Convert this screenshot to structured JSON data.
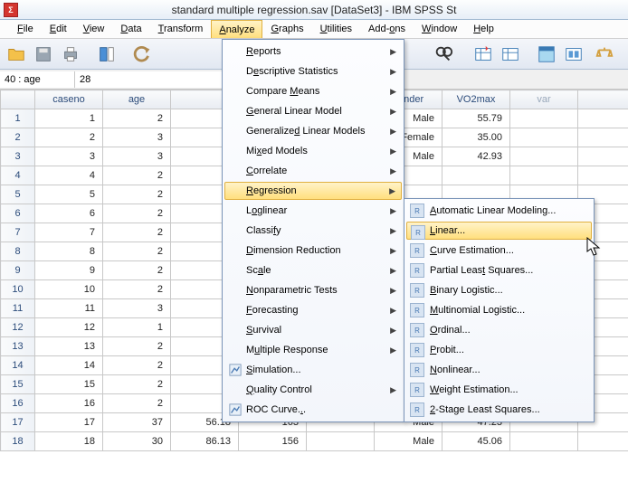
{
  "title": "standard multiple regression.sav [DataSet3] - IBM SPSS St",
  "menubar": {
    "file": "File",
    "edit": "Edit",
    "view": "View",
    "data": "Data",
    "transform": "Transform",
    "analyze": "Analyze",
    "graphs": "Graphs",
    "utilities": "Utilities",
    "addons": "Add-ons",
    "window": "Window",
    "help": "Help"
  },
  "nav": {
    "label": "40 : age",
    "value": "28"
  },
  "columns": {
    "c0": "caseno",
    "c1": "age",
    "c2": "gender",
    "c3": "VO2max",
    "c4": "var"
  },
  "rows": [
    {
      "n": "1",
      "caseno": "1",
      "age": "2",
      "gender": "Male",
      "vo2": "55.79"
    },
    {
      "n": "2",
      "caseno": "2",
      "age": "3",
      "gender": "Female",
      "vo2": "35.00"
    },
    {
      "n": "3",
      "caseno": "3",
      "age": "3",
      "gender": "Male",
      "vo2": "42.93"
    },
    {
      "n": "4",
      "caseno": "4",
      "age": "2",
      "gender": "",
      "vo2": ""
    },
    {
      "n": "5",
      "caseno": "5",
      "age": "2",
      "gender": "",
      "vo2": ""
    },
    {
      "n": "6",
      "caseno": "6",
      "age": "2",
      "gender": "",
      "vo2": ""
    },
    {
      "n": "7",
      "caseno": "7",
      "age": "2",
      "gender": "",
      "vo2": ""
    },
    {
      "n": "8",
      "caseno": "8",
      "age": "2",
      "gender": "",
      "vo2": ""
    },
    {
      "n": "9",
      "caseno": "9",
      "age": "2",
      "gender": "",
      "vo2": ""
    },
    {
      "n": "10",
      "caseno": "10",
      "age": "2",
      "gender": "",
      "vo2": ""
    },
    {
      "n": "11",
      "caseno": "11",
      "age": "3",
      "gender": "",
      "vo2": ""
    },
    {
      "n": "12",
      "caseno": "12",
      "age": "1",
      "gender": "",
      "vo2": ""
    },
    {
      "n": "13",
      "caseno": "13",
      "age": "2",
      "gender": "",
      "vo2": ""
    },
    {
      "n": "14",
      "caseno": "14",
      "age": "2",
      "gender": "",
      "vo2": ""
    },
    {
      "n": "15",
      "caseno": "15",
      "age": "2",
      "gender": "",
      "vo2": ""
    },
    {
      "n": "16",
      "caseno": "16",
      "age": "2",
      "gender": "",
      "vo2": ""
    },
    {
      "n": "17",
      "caseno": "17",
      "age_full": "37",
      "w": "56.18",
      "h": "163",
      "gender": "Male",
      "vo2": "47.23"
    },
    {
      "n": "18",
      "caseno": "18",
      "age_full": "30",
      "w": "86.13",
      "h": "156",
      "gender": "Male",
      "vo2": "45.06"
    }
  ],
  "analyze_menu": [
    {
      "label": "Reports",
      "arrow": true,
      "u": 0
    },
    {
      "label": "Descriptive Statistics",
      "arrow": true,
      "u": 1
    },
    {
      "label": "Compare Means",
      "arrow": true,
      "u": 8
    },
    {
      "label": "General Linear Model",
      "arrow": true,
      "u": 0
    },
    {
      "label": "Generalized Linear Models",
      "arrow": true,
      "u": 10
    },
    {
      "label": "Mixed Models",
      "arrow": true,
      "u": 2
    },
    {
      "label": "Correlate",
      "arrow": true,
      "u": 0
    },
    {
      "label": "Regression",
      "arrow": true,
      "u": 0,
      "hl": true
    },
    {
      "label": "Loglinear",
      "arrow": true,
      "u": 1
    },
    {
      "label": "Classify",
      "arrow": true,
      "u": 6
    },
    {
      "label": "Dimension Reduction",
      "arrow": true,
      "u": 0
    },
    {
      "label": "Scale",
      "arrow": true,
      "u": 2
    },
    {
      "label": "Nonparametric Tests",
      "arrow": true,
      "u": 0
    },
    {
      "label": "Forecasting",
      "arrow": true,
      "u": 0
    },
    {
      "label": "Survival",
      "arrow": true,
      "u": 0
    },
    {
      "label": "Multiple Response",
      "arrow": true,
      "u": 1
    },
    {
      "label": "Simulation...",
      "arrow": false,
      "icon": "sim",
      "u": 0
    },
    {
      "label": "Quality Control",
      "arrow": true,
      "u": 0
    },
    {
      "label": "ROC Curve...",
      "arrow": false,
      "icon": "roc",
      "u": 10
    }
  ],
  "regression_submenu": [
    {
      "label": "Automatic Linear Modeling...",
      "u": 0
    },
    {
      "label": "Linear...",
      "u": 0,
      "hl": true
    },
    {
      "label": "Curve Estimation...",
      "u": 0
    },
    {
      "label": "Partial Least Squares...",
      "u": 12
    },
    {
      "label": "Binary Logistic...",
      "u": 0
    },
    {
      "label": "Multinomial Logistic...",
      "u": 0
    },
    {
      "label": "Ordinal...",
      "u": 0
    },
    {
      "label": "Probit...",
      "u": 0
    },
    {
      "label": "Nonlinear...",
      "u": 0
    },
    {
      "label": "Weight Estimation...",
      "u": 0
    },
    {
      "label": "2-Stage Least Squares...",
      "u": 0
    }
  ]
}
